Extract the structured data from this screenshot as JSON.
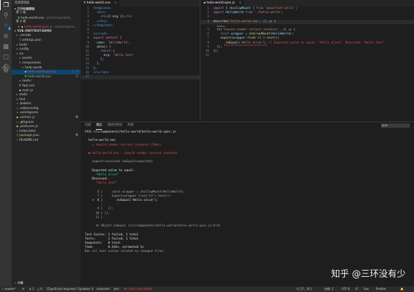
{
  "sidebar": {
    "title": "资源管理器",
    "open_editors_label": "打开的编辑器",
    "group1_label": "第 1 组",
    "group1_file": "hello-world.vue",
    "group1_path": "src/components...",
    "group2_label": "第 2 组",
    "group2_file": "hello-world.spec.js",
    "group2_path": "src/compone...",
    "group2_count": "1",
    "project_label": "VUE-UNIT-TEST-DEMO",
    "tree": [
      {
        "label": ".vscode",
        "kind": "folder",
        "indent": 1,
        "status": ""
      },
      {
        "label": "settings.json",
        "kind": "json",
        "indent": 2,
        "status": ""
      },
      {
        "label": "build",
        "kind": "folder",
        "indent": 1,
        "status": ""
      },
      {
        "label": "config",
        "kind": "folder",
        "indent": 1,
        "status": ""
      },
      {
        "label": "src",
        "kind": "folder-open",
        "indent": 1,
        "status": ""
      },
      {
        "label": "assets",
        "kind": "folder",
        "indent": 2,
        "status": ""
      },
      {
        "label": "components",
        "kind": "folder-open",
        "indent": 2,
        "status": ""
      },
      {
        "label": "hello-world",
        "kind": "folder-open",
        "indent": 3,
        "status": ""
      },
      {
        "label": "hello-world.spec.js",
        "kind": "js",
        "indent": 4,
        "status": "1, U",
        "selected": true
      },
      {
        "label": "hello-world.vue",
        "kind": "vue",
        "indent": 4,
        "status": "U"
      },
      {
        "label": "router",
        "kind": "folder",
        "indent": 2,
        "status": ""
      },
      {
        "label": "App.vue",
        "kind": "vue",
        "indent": 2,
        "status": ""
      },
      {
        "label": "main.js",
        "kind": "js",
        "indent": 2,
        "status": ""
      },
      {
        "label": "static",
        "kind": "folder",
        "indent": 1,
        "status": ""
      },
      {
        "label": "test",
        "kind": "folder",
        "indent": 1,
        "status": ""
      },
      {
        "label": ".babelrc",
        "kind": "file",
        "indent": 1,
        "status": ""
      },
      {
        "label": ".editorconfig",
        "kind": "file",
        "indent": 1,
        "status": ""
      },
      {
        "label": ".eslintignore",
        "kind": "file",
        "indent": 1,
        "status": ""
      },
      {
        "label": ".eslintrc.js",
        "kind": "js",
        "indent": 1,
        "status": "M"
      },
      {
        "label": ".gitignore",
        "kind": "file",
        "indent": 1,
        "status": ""
      },
      {
        "label": ".postcssrc.js",
        "kind": "js",
        "indent": 1,
        "status": ""
      },
      {
        "label": "index.html",
        "kind": "html",
        "indent": 1,
        "status": ""
      },
      {
        "label": "package.json",
        "kind": "json",
        "indent": 1,
        "status": "M"
      },
      {
        "label": "README.md",
        "kind": "md",
        "indent": 1,
        "status": ""
      }
    ],
    "outline_label": "大纲"
  },
  "activity_badge": "1",
  "tabs": {
    "left": "hello-world.vue",
    "right": "hello-world.spec.js"
  },
  "editor_left": {
    "lines": [
      {
        "n": "1",
        "html": "<span class='tg'>&lt;template&gt;</span>"
      },
      {
        "n": "2",
        "html": "  <span class='tg'>&lt;div&gt;</span>"
      },
      {
        "n": "3",
        "html": "    <span class='tg'>&lt;h1&gt;</span><span class='pn'>{{ msg }}</span><span class='tg'>&lt;/h1&gt;</span>"
      },
      {
        "n": "4",
        "html": "  <span class='tg'>&lt;/div&gt;</span>"
      },
      {
        "n": "5",
        "html": "<span class='tg'>&lt;/template&gt;</span>"
      },
      {
        "n": "6",
        "html": ""
      },
      {
        "n": "7",
        "html": "<span class='tg'>&lt;script&gt;</span>"
      },
      {
        "n": "8",
        "html": "<span class='kw'>export</span> <span class='kw'>default</span> <span class='pn'>{</span>"
      },
      {
        "n": "9",
        "html": "  <span class='vr'>name</span><span class='pn'>:</span> <span class='st'>'HelloWorld'</span><span class='pn'>,</span>"
      },
      {
        "n": "10",
        "html": "  <span class='fn'>data</span><span class='pn'>() {</span>"
      },
      {
        "n": "11",
        "html": "    <span class='kw'>return</span> <span class='pn'>{</span>"
      },
      {
        "n": "12",
        "html": "      <span class='vr'>msg</span><span class='pn'>:</span> <span class='st'>'Hello Jest'</span>"
      },
      {
        "n": "13",
        "html": "    <span class='pn'>};</span>"
      },
      {
        "n": "14",
        "html": "  <span class='pn'>},</span>"
      },
      {
        "n": "15",
        "html": "<span class='pn'>};</span>"
      },
      {
        "n": "16",
        "html": "<span class='tg'>&lt;/script&gt;</span>"
      },
      {
        "n": "17",
        "html": "",
        "current": true
      }
    ]
  },
  "editor_right": {
    "lines": [
      {
        "n": "1",
        "html": "<span class='kw'>import</span> <span class='pn'>{</span> <span class='vr'>shallowMount</span> <span class='pn'>}</span> <span class='kw'>from</span> <span class='st'>'@vue/test-utils'</span><span class='pn'>;</span>"
      },
      {
        "n": "2",
        "html": "<span class='kw'>import</span> <span class='vr'>HelloWorld</span> <span class='kw'>from</span> <span class='st'>'./hello-world'</span><span class='pn'>;</span>"
      },
      {
        "n": "3",
        "html": ""
      },
      {
        "n": "4",
        "html": "<span class='fn'>describe</span><span class='pn'>(</span><span class='st'>'hello-world.vue'</span><span class='pn'>, () =&gt; {</span>",
        "current": true
      },
      {
        "n": "",
        "html": "  <span class='codelens'>Debug</span>"
      },
      {
        "n": "5",
        "html": "  <span class='fn'>it</span><span class='pn'>(</span><span class='st'>'should render correct contents'</span><span class='pn'>, () =&gt; {</span>"
      },
      {
        "n": "6",
        "html": "    <span class='kb'>const</span> <span class='vr'>wrapper</span> <span class='pn'>=</span> <span class='fn'>shallowMount</span><span class='pn'>(</span><span class='vr'>HelloWorld</span><span class='pn'>);</span>"
      },
      {
        "n": "7",
        "html": "    <span class='fn'>expect</span><span class='pn'>(</span><span class='vr'>wrapper</span><span class='pn'>.</span><span class='fn'>find</span><span class='pn'>(</span><span class='st'>'h1'</span><span class='pn'>).</span><span class='fn'>text</span><span class='pn'>())</span>"
      },
      {
        "n": "8",
        "html": "      <span class='squig'><span class='pn'>.</span><span class='fn'>toEqual</span><span class='pn'>(</span><span class='st'>'Hello olive'</span><span class='pn'>);</span></span> <span class='err-inline'>// Expected value to equal: \"Hello olive\", Received: \"Hello Jest\"</span>"
      },
      {
        "n": "9",
        "html": "  <span class='pn'>});</span>"
      },
      {
        "n": "10",
        "html": "<span class='pn'>});</span>"
      },
      {
        "n": "11",
        "html": ""
      }
    ]
  },
  "panel": {
    "tabs": [
      "问题",
      "输出",
      "调试控制台",
      "终端"
    ],
    "active_tab": 1,
    "terminal_select": "Jest"
  },
  "terminal": {
    "lines": [
      {
        "c": "t-white",
        "t": "FAIL src/components/hello-world/hello-world.spec.js"
      },
      {
        "c": "",
        "t": ""
      },
      {
        "c": "t-white",
        "t": "  hello-world.vue"
      },
      {
        "c": "t-red",
        "t": "    × should render correct contents (19ms)"
      },
      {
        "c": "",
        "t": ""
      },
      {
        "c": "t-red",
        "t": "  ● hello-world.vue › should render correct contents"
      },
      {
        "c": "",
        "t": ""
      },
      {
        "c": "t-dim",
        "t": "    expect(received).toEqual(expected)"
      },
      {
        "c": "",
        "t": ""
      },
      {
        "c": "t-white",
        "t": "    Expected value to equal:"
      },
      {
        "c": "t-green",
        "t": "      \"Hello olive\""
      },
      {
        "c": "t-white",
        "t": "    Received:"
      },
      {
        "c": "t-red",
        "t": "      \"Hello Jest\""
      },
      {
        "c": "",
        "t": ""
      },
      {
        "c": "t-dim",
        "t": "       6 |     const wrapper = shallowMount(HelloWorld);"
      },
      {
        "c": "t-dim",
        "t": "       7 |     expect(wrapper.find('h1').text())"
      },
      {
        "c": "t-white",
        "t": "    >  8 |       .toEqual('Hello olive');"
      },
      {
        "c": "t-red",
        "t": "         |        ^"
      },
      {
        "c": "t-dim",
        "t": "       9 |   });"
      },
      {
        "c": "t-dim",
        "t": "      10 | });"
      },
      {
        "c": "t-dim",
        "t": "      11 |"
      },
      {
        "c": "",
        "t": ""
      },
      {
        "c": "t-dim",
        "t": "      at Object.toEqual (src/components/hello-world/hello-world.spec.js:8:8)"
      },
      {
        "c": "",
        "t": ""
      },
      {
        "c": "t-white",
        "t": "Test Suites: 1 failed, 1 total"
      },
      {
        "c": "t-white",
        "t": "Tests:       1 failed, 1 total"
      },
      {
        "c": "t-white",
        "t": "Snapshots:   0 total"
      },
      {
        "c": "t-white",
        "t": "Time:        0.344s, estimated 1s"
      },
      {
        "c": "t-dim",
        "t": "Ran all test suites related to changed files."
      }
    ]
  },
  "statusbar": {
    "branch": "master*",
    "sync": "⟳",
    "errors": "⊗ 1",
    "warnings": "△ 0",
    "lang": "[TypeScript Importer]: Symbols: 0",
    "user": "oliveshell",
    "jest": "Jest",
    "jest_result": "✖ 1 test suite failed",
    "position": "行 17，列 1",
    "spaces": "空格: 2",
    "encoding": "UTF-8",
    "eol": "LF",
    "language": "Vue",
    "prettier": "Prettier"
  },
  "watermark": "知乎 @三环没有少"
}
